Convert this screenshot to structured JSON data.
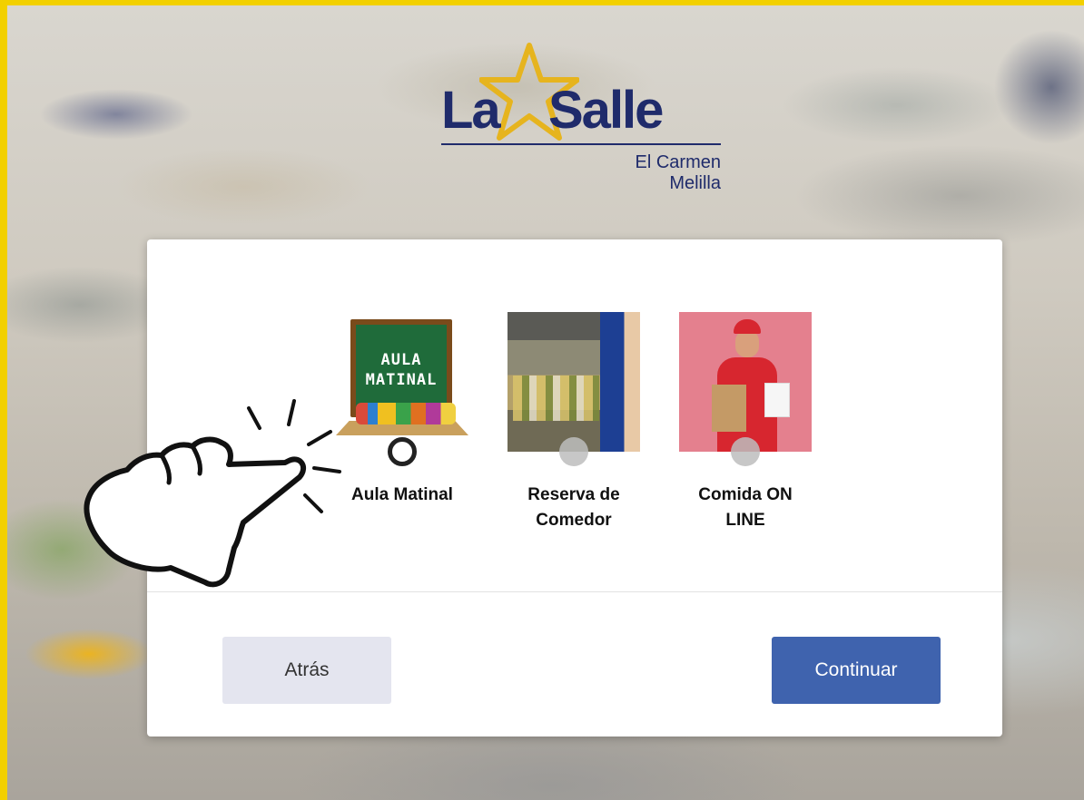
{
  "logo": {
    "brand_part1": "La",
    "brand_part2": "Salle",
    "subtitle_line1": "El Carmen",
    "subtitle_line2": "Melilla",
    "colors": {
      "navy": "#1f2b6b",
      "gold": "#e6b41e"
    }
  },
  "options": [
    {
      "label": "Aula Matinal",
      "image_text": "AULA MATINAL",
      "selected": true,
      "icon": "chalkboard-image"
    },
    {
      "label": "Reserva de Comedor",
      "selected": false,
      "icon": "canteen-photo"
    },
    {
      "label": "Comida ON LINE",
      "selected": false,
      "icon": "delivery-person-photo"
    }
  ],
  "buttons": {
    "back_label": "Atrás",
    "continue_label": "Continuar"
  },
  "colors": {
    "border": "#f2d000",
    "primary": "#3f63ae",
    "secondary": "#e4e5ef"
  },
  "decoration": {
    "pointer": "pointing-hand-icon"
  }
}
